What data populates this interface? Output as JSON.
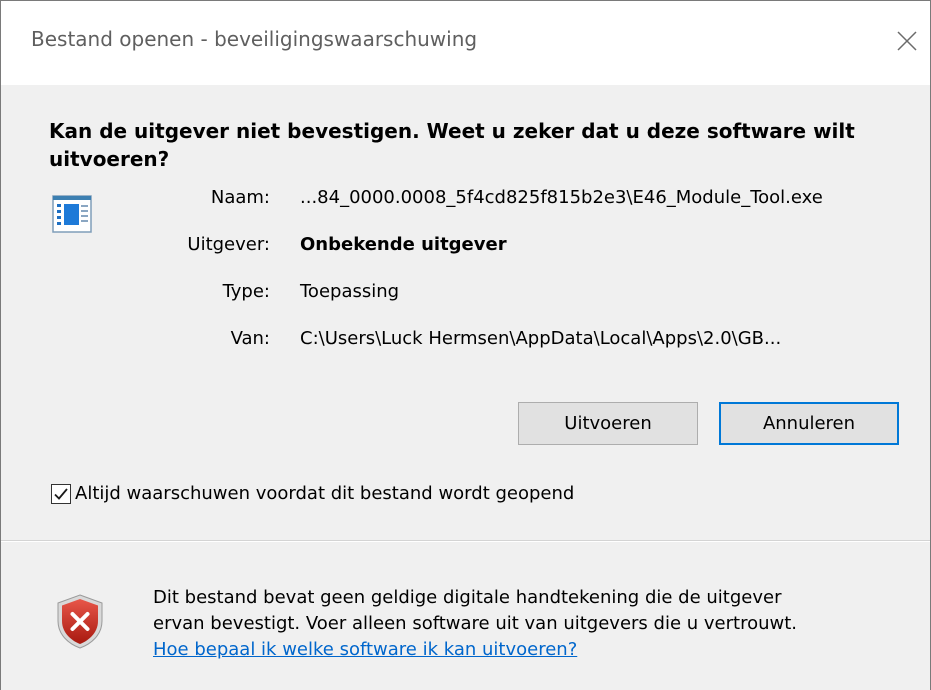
{
  "dialog": {
    "title": "Bestand openen - beveiligingswaarschuwing",
    "heading": "Kan de uitgever niet bevestigen. Weet u zeker dat u deze software wilt uitvoeren?"
  },
  "file_info": {
    "name_label": "Naam:",
    "name_value": "...84_0000.0008_5f4cd825f815b2e3\\E46_Module_Tool.exe",
    "publisher_label": "Uitgever:",
    "publisher_value": "Onbekende uitgever",
    "type_label": "Type:",
    "type_value": "Toepassing",
    "from_label": "Van:",
    "from_value": "C:\\Users\\Luck Hermsen\\AppData\\Local\\Apps\\2.0\\GB..."
  },
  "buttons": {
    "run_label": "Uitvoeren",
    "cancel_label": "Annuleren"
  },
  "checkbox": {
    "label": "Altijd waarschuwen voordat dit bestand wordt geopend",
    "checked": true
  },
  "warning": {
    "line1": "Dit bestand bevat geen geldige digitale handtekening die de uitgever",
    "line2": "ervan bevestigt. Voer alleen software uit van uitgevers die u vertrouwt.",
    "link_text": "Hoe bepaal ik welke software ik kan uitvoeren?"
  },
  "icons": {
    "close": "close-icon",
    "application": "application-icon",
    "shield": "shield-error-icon",
    "checkmark": "checkmark-icon"
  },
  "colors": {
    "accent": "#0078d7",
    "link": "#0066cc",
    "shield_red": "#c42b1c",
    "dialog_bg": "#f0f0f0"
  }
}
